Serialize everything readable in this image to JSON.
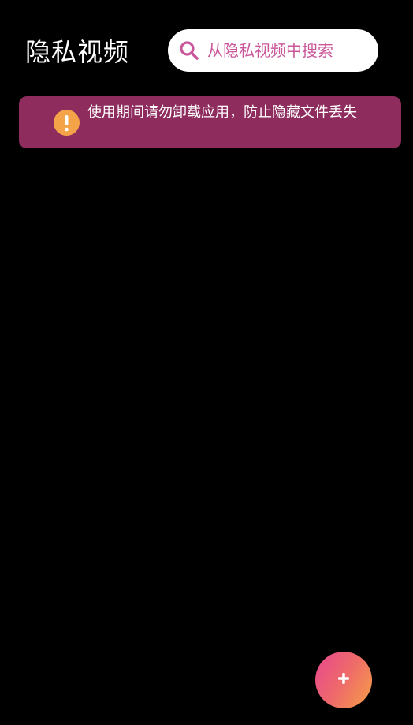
{
  "header": {
    "title": "隐私视频"
  },
  "search": {
    "placeholder": "从隐私视频中搜索",
    "icon": "search-icon"
  },
  "notice": {
    "text": "使用期间请勿卸载应用，防止隐藏文件丢失",
    "icon": "exclamation-icon"
  },
  "fab": {
    "icon": "plus-icon"
  },
  "colors": {
    "background": "#000000",
    "accent_pink": "#c9579a",
    "notice_background": "#8e2c5e",
    "warning_orange": "#f5a348",
    "fab_gradient_start": "#e8478f",
    "fab_gradient_end": "#f7a046"
  }
}
